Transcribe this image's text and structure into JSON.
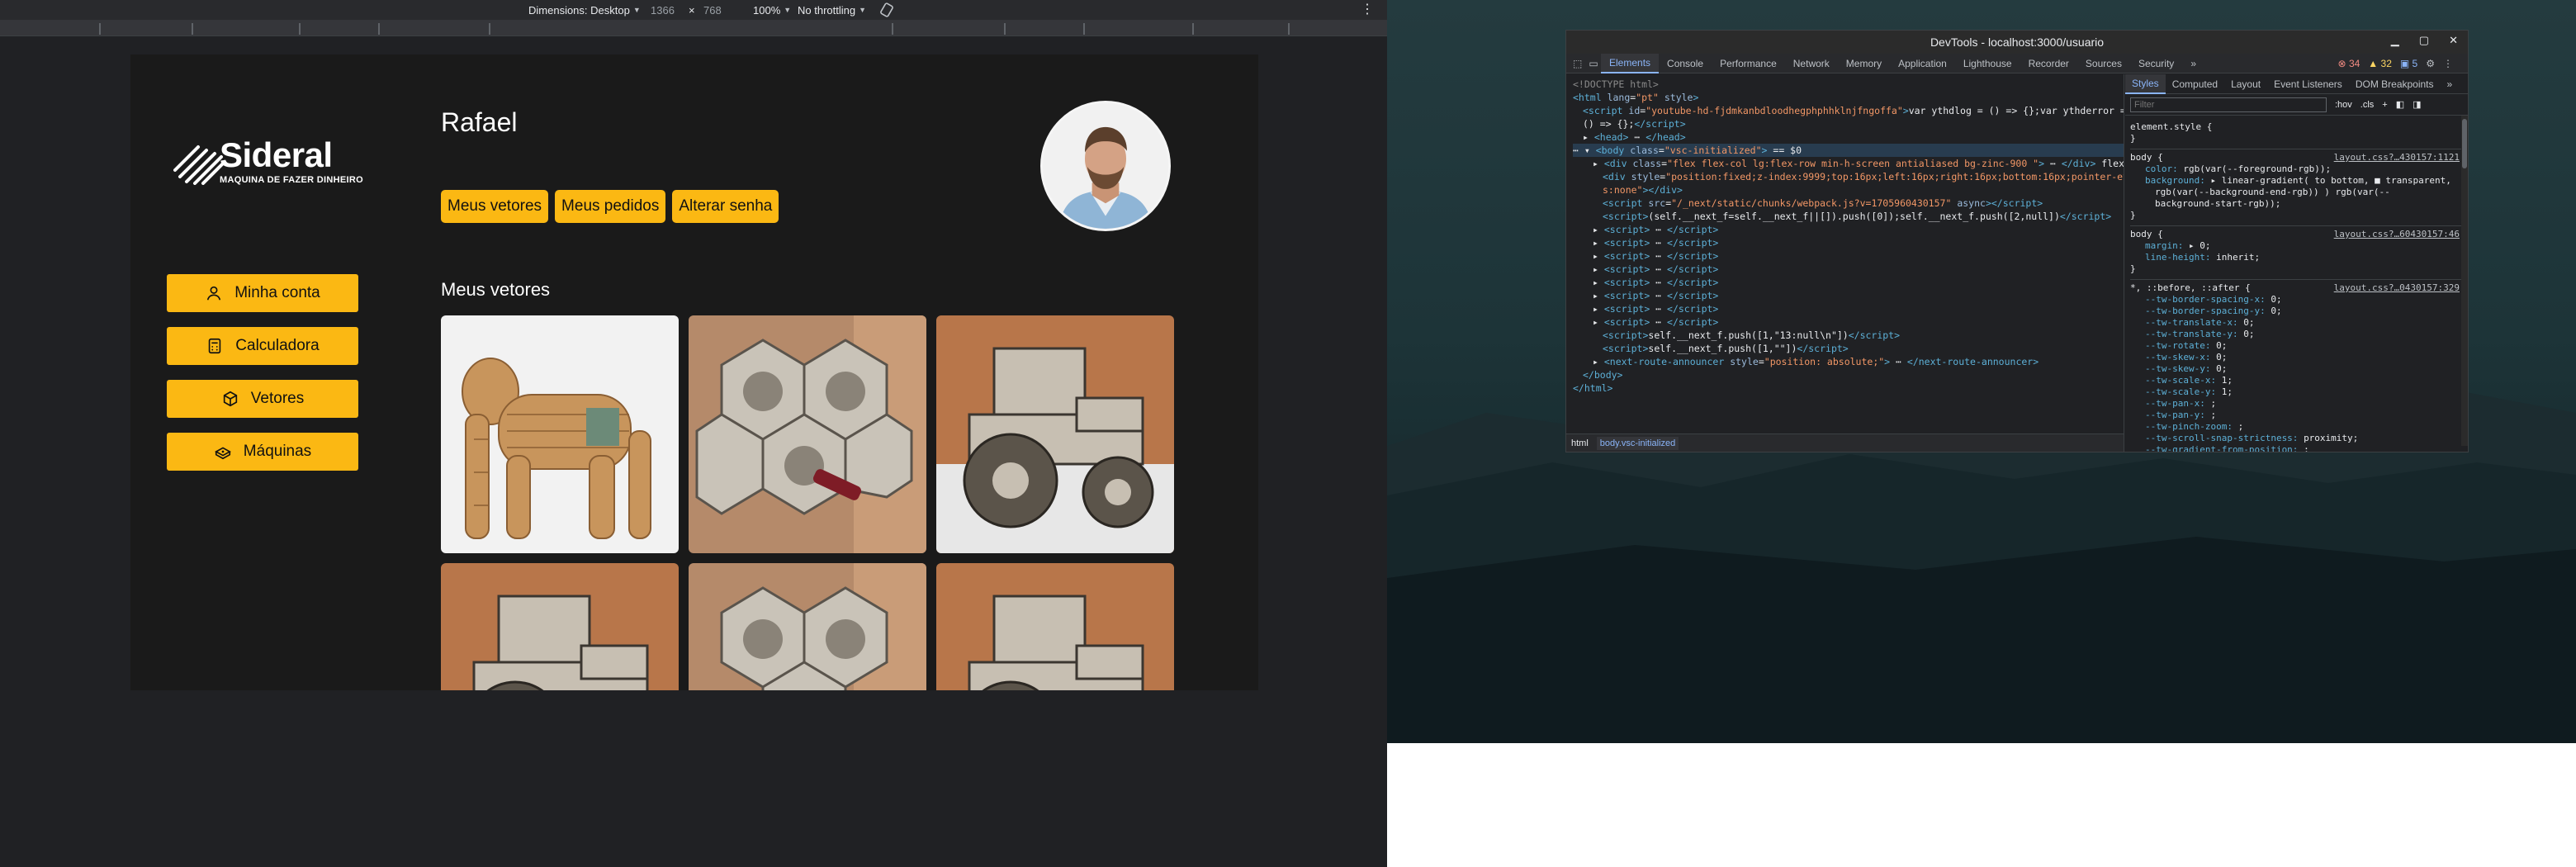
{
  "device_toolbar": {
    "dimensions_label": "Dimensions: Desktop",
    "width": "1366",
    "times": "×",
    "height": "768",
    "zoom": "100%",
    "throttling": "No throttling"
  },
  "site": {
    "logo_name": "Sideral",
    "logo_tagline": "MAQUINA DE FAZER DINHEIRO",
    "nav": [
      {
        "label": "Minha conta",
        "icon": "user-icon"
      },
      {
        "label": "Calculadora",
        "icon": "calculator-icon"
      },
      {
        "label": "Vetores",
        "icon": "cube-icon"
      },
      {
        "label": "Máquinas",
        "icon": "machine-icon"
      }
    ],
    "profile_name": "Rafael",
    "tabs": [
      "Meus vetores",
      "Meus pedidos",
      "Alterar senha"
    ],
    "section_title": "Meus vetores",
    "products": [
      {
        "kind": "gorilla-shelf"
      },
      {
        "kind": "hexagon-wine-rack"
      },
      {
        "kind": "tractor"
      },
      {
        "kind": "tractor"
      },
      {
        "kind": "hexagon-wine-rack"
      },
      {
        "kind": "tractor"
      }
    ],
    "colors": {
      "accent": "#fbb813",
      "background": "#1a1a1a"
    }
  },
  "devtools": {
    "title": "DevTools - localhost:3000/usuario",
    "tabs": [
      "Elements",
      "Console",
      "Performance",
      "Network",
      "Memory",
      "Application",
      "Lighthouse",
      "Recorder",
      "Sources",
      "Security"
    ],
    "overflow": "»",
    "errors": "34",
    "warnings": "32",
    "infos": "5",
    "code_lines": [
      {
        "indent": 0,
        "html": "<span class='cmt'>&lt;!DOCTYPE html&gt;</span>"
      },
      {
        "indent": 0,
        "html": "<span class='tag'>&lt;html</span> <span class='attr'>lang</span>=<span class='val'>\"pt\"</span> <span class='attr'>style</span><span class='tag'>&gt;</span>"
      },
      {
        "indent": 1,
        "html": "<span class='tag'>&lt;script</span> <span class='attr'>id</span>=<span class='val'>\"youtube-hd-fjdmkanbdloodhegphphhklnjfngoffa\"</span><span class='tag'>&gt;</span>var ythdlog = () =&gt; {};var ythderror ="
      },
      {
        "indent": 1,
        "html": "() =&gt; {};<span class='tag'>&lt;/script&gt;</span>"
      },
      {
        "indent": 1,
        "html": "▸ <span class='tag'>&lt;head&gt;</span> ⋯ <span class='tag'>&lt;/head&gt;</span>"
      },
      {
        "indent": 0,
        "html": "⋯ ▾ <span class='tag'>&lt;body</span> <span class='attr'>class</span>=<span class='val'>\"vsc-initialized\"</span><span class='tag'>&gt;</span> == $0",
        "selected": true
      },
      {
        "indent": 2,
        "html": "▸ <span class='tag'>&lt;div</span> <span class='attr'>class</span>=<span class='val'>\"flex flex-col lg:flex-row min-h-screen antialiased  bg-zinc-900 \"</span><span class='tag'>&gt;</span> ⋯ <span class='tag'>&lt;/div&gt;</span> flex"
      },
      {
        "indent": 3,
        "html": "<span class='tag'>&lt;div</span> <span class='attr'>style</span>=<span class='val'>\"position:fixed;z-index:9999;top:16px;left:16px;right:16px;bottom:16px;pointer-event</span>"
      },
      {
        "indent": 3,
        "html": "<span class='val'>s:none\"</span><span class='tag'>&gt;&lt;/div&gt;</span>"
      },
      {
        "indent": 3,
        "html": "<span class='tag'>&lt;script</span> <span class='attr'>src</span>=<span class='val'>\"/_next/static/chunks/webpack.js?v=1705960430157\"</span> <span class='attr'>async</span><span class='tag'>&gt;&lt;/script&gt;</span>"
      },
      {
        "indent": 3,
        "html": "<span class='tag'>&lt;script&gt;</span>(self.__next_f=self.__next_f||[]).push([0]);self.__next_f.push([2,null])<span class='tag'>&lt;/script&gt;</span>"
      },
      {
        "indent": 2,
        "html": "▸ <span class='tag'>&lt;script&gt;</span> ⋯ <span class='tag'>&lt;/script&gt;</span>"
      },
      {
        "indent": 2,
        "html": "▸ <span class='tag'>&lt;script&gt;</span> ⋯ <span class='tag'>&lt;/script&gt;</span>"
      },
      {
        "indent": 2,
        "html": "▸ <span class='tag'>&lt;script&gt;</span> ⋯ <span class='tag'>&lt;/script&gt;</span>"
      },
      {
        "indent": 2,
        "html": "▸ <span class='tag'>&lt;script&gt;</span> ⋯ <span class='tag'>&lt;/script&gt;</span>"
      },
      {
        "indent": 2,
        "html": "▸ <span class='tag'>&lt;script&gt;</span> ⋯ <span class='tag'>&lt;/script&gt;</span>"
      },
      {
        "indent": 2,
        "html": "▸ <span class='tag'>&lt;script&gt;</span> ⋯ <span class='tag'>&lt;/script&gt;</span>"
      },
      {
        "indent": 2,
        "html": "▸ <span class='tag'>&lt;script&gt;</span> ⋯ <span class='tag'>&lt;/script&gt;</span>"
      },
      {
        "indent": 2,
        "html": "▸ <span class='tag'>&lt;script&gt;</span> ⋯ <span class='tag'>&lt;/script&gt;</span>"
      },
      {
        "indent": 3,
        "html": "<span class='tag'>&lt;script&gt;</span>self.__next_f.push([1,\"13:null\\n\"])<span class='tag'>&lt;/script&gt;</span>"
      },
      {
        "indent": 3,
        "html": "<span class='tag'>&lt;script&gt;</span>self.__next_f.push([1,\"\"])<span class='tag'>&lt;/script&gt;</span>"
      },
      {
        "indent": 2,
        "html": "▸ <span class='tag'>&lt;next-route-announcer</span> <span class='attr'>style</span>=<span class='val'>\"position: absolute;\"</span><span class='tag'>&gt;</span> ⋯ <span class='tag'>&lt;/next-route-announcer&gt;</span>"
      },
      {
        "indent": 1,
        "html": "<span class='tag'>&lt;/body&gt;</span>"
      },
      {
        "indent": 0,
        "html": "<span class='tag'>&lt;/html&gt;</span>"
      }
    ],
    "breadcrumbs": [
      "html",
      "body.vsc-initialized"
    ],
    "styles_tabs": [
      "Styles",
      "Computed",
      "Layout",
      "Event Listeners",
      "DOM Breakpoints"
    ],
    "filter_placeholder": "Filter",
    "hov": ":hov",
    "cls": ".cls",
    "rules": [
      {
        "selector": "element.style {",
        "source": "",
        "props": [],
        "close": "}"
      },
      {
        "selector": "body {",
        "source": "layout.css?…430157:1121",
        "props": [
          {
            "name": "color",
            "value": "rgb(var(--foreground-rgb));"
          },
          {
            "name": "background",
            "value": "▸ linear-gradient( to bottom, ■ transparent,"
          },
          {
            "name": "",
            "value": "rgb(var(--background-end-rgb)) ) rgb(var(--"
          },
          {
            "name": "",
            "value": "background-start-rgb));"
          }
        ],
        "close": "}"
      },
      {
        "selector": "body {",
        "source": "layout.css?…60430157:46",
        "props": [
          {
            "name": "margin",
            "value": "▸ 0;"
          },
          {
            "name": "line-height",
            "value": "inherit;"
          }
        ],
        "close": "}"
      },
      {
        "selector": "*, ::before, ::after {",
        "source": "layout.css?…0430157:329",
        "props": [
          {
            "name": "--tw-border-spacing-x",
            "value": "0;"
          },
          {
            "name": "--tw-border-spacing-y",
            "value": "0;"
          },
          {
            "name": "--tw-translate-x",
            "value": "0;"
          },
          {
            "name": "--tw-translate-y",
            "value": "0;"
          },
          {
            "name": "--tw-rotate",
            "value": "0;"
          },
          {
            "name": "--tw-skew-x",
            "value": "0;"
          },
          {
            "name": "--tw-skew-y",
            "value": "0;"
          },
          {
            "name": "--tw-scale-x",
            "value": "1;"
          },
          {
            "name": "--tw-scale-y",
            "value": "1;"
          },
          {
            "name": "--tw-pan-x",
            "value": ";"
          },
          {
            "name": "--tw-pan-y",
            "value": ";"
          },
          {
            "name": "--tw-pinch-zoom",
            "value": ";"
          },
          {
            "name": "--tw-scroll-snap-strictness",
            "value": "proximity;"
          },
          {
            "name": "--tw-gradient-from-position",
            "value": ";"
          }
        ],
        "close": ""
      }
    ]
  }
}
